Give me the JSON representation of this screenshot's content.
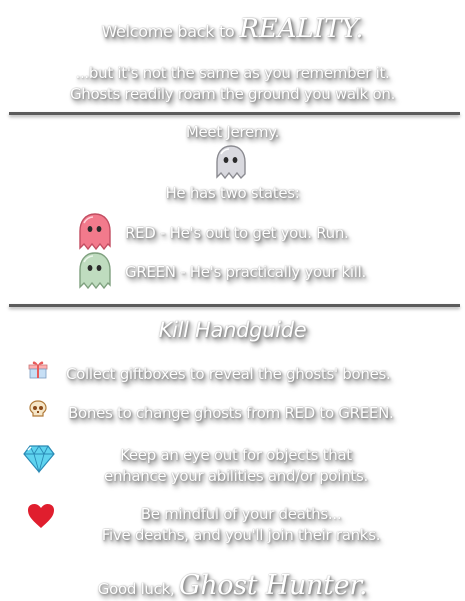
{
  "header": {
    "title_prefix": "Welcome back to",
    "title_brand": "REALITY.",
    "intro_line1": "...but it's not the same as you remember it.",
    "intro_line2": "Ghosts readily roam the ground you walk on."
  },
  "ghost_section": {
    "meet": "Meet Jeremy.",
    "two_states": "He has two states:",
    "states": [
      {
        "label": "RED - He's out to get you. Run.",
        "icon": "red-ghost-icon",
        "color": "#f27a8c"
      },
      {
        "label": "GREEN - He's practically your kill.",
        "icon": "green-ghost-icon",
        "color": "#bfdcbf"
      }
    ]
  },
  "kill_handguide": {
    "heading": "Kill Handguide",
    "items": [
      {
        "icon": "giftbox-icon",
        "line1": "Collect giftboxes to reveal the ghosts' bones.",
        "line2": ""
      },
      {
        "icon": "skull-icon",
        "line1": "Bones to change ghosts from RED to GREEN.",
        "line2": ""
      },
      {
        "icon": "diamond-icon",
        "line1": "Keep an eye out for objects that",
        "line2": "enhance your abilities and/or points."
      },
      {
        "icon": "heart-icon",
        "line1": "Be mindful of your deaths...",
        "line2": "Five deaths, and you'll join their ranks."
      }
    ]
  },
  "footer": {
    "prefix": "Good luck,",
    "brand": "Ghost Hunter."
  },
  "colors": {
    "divider": "#5c5c5c",
    "heart": "#e01e2e",
    "diamond": "#5fd3ef",
    "ghost_white": "#d9d9df"
  }
}
